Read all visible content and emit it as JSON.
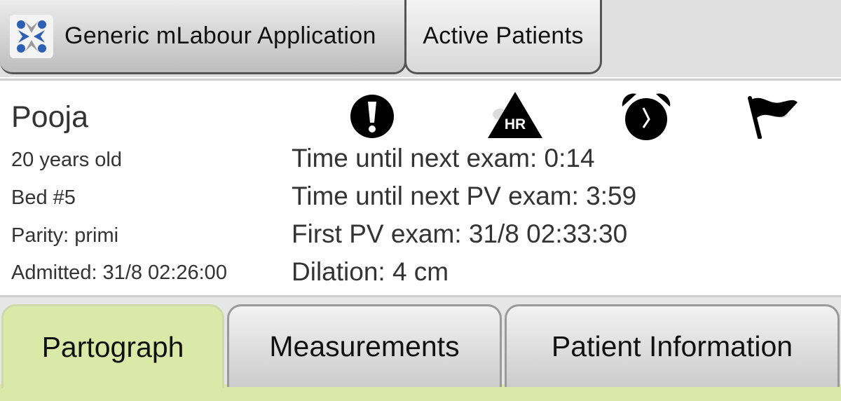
{
  "header": {
    "app_title": "Generic mLabour Application",
    "active_patients_label": "Active Patients"
  },
  "patient": {
    "name": "Pooja",
    "age": "20 years old",
    "bed": "Bed #5",
    "parity": "Parity: primi",
    "admitted": "Admitted: 31/8 02:26:00"
  },
  "status": {
    "next_exam": "Time until next exam: 0:14",
    "next_pv_exam": "Time until next PV exam: 3:59",
    "first_pv_exam": "First PV exam: 31/8 02:33:30",
    "dilation": "Dilation: 4 cm"
  },
  "alert_icons": {
    "warning": "exclamation-icon",
    "heart_rate": "HR",
    "alarm": "alarm-clock-icon",
    "flag": "flag-icon"
  },
  "tabs": [
    {
      "label": "Partograph",
      "active": true
    },
    {
      "label": "Measurements",
      "active": false
    },
    {
      "label": "Patient Information",
      "active": false
    }
  ],
  "colors": {
    "active_tab": "#dbe9a8",
    "logo_blue": "#2d5fb4"
  }
}
